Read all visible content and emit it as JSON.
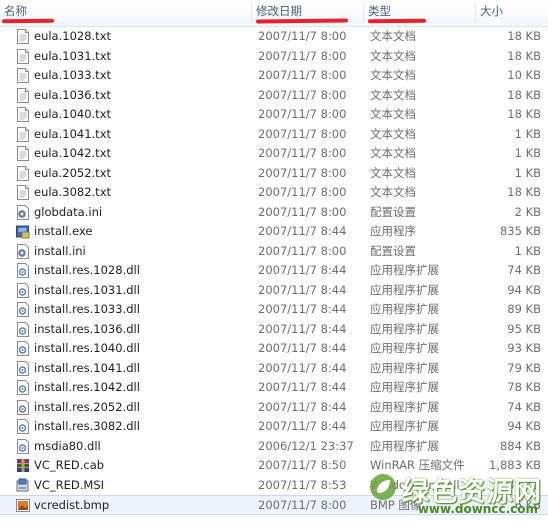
{
  "columns": {
    "name": "名称",
    "date": "修改日期",
    "type": "类型",
    "size": "大小"
  },
  "files": [
    {
      "name": "eula.1028.txt",
      "date": "2007/11/7 8:00",
      "type": "文本文档",
      "size": "18 KB",
      "icon": "text-file-icon"
    },
    {
      "name": "eula.1031.txt",
      "date": "2007/11/7 8:00",
      "type": "文本文档",
      "size": "18 KB",
      "icon": "text-file-icon"
    },
    {
      "name": "eula.1033.txt",
      "date": "2007/11/7 8:00",
      "type": "文本文档",
      "size": "10 KB",
      "icon": "text-file-icon"
    },
    {
      "name": "eula.1036.txt",
      "date": "2007/11/7 8:00",
      "type": "文本文档",
      "size": "18 KB",
      "icon": "text-file-icon"
    },
    {
      "name": "eula.1040.txt",
      "date": "2007/11/7 8:00",
      "type": "文本文档",
      "size": "18 KB",
      "icon": "text-file-icon"
    },
    {
      "name": "eula.1041.txt",
      "date": "2007/11/7 8:00",
      "type": "文本文档",
      "size": "1 KB",
      "icon": "text-file-icon"
    },
    {
      "name": "eula.1042.txt",
      "date": "2007/11/7 8:00",
      "type": "文本文档",
      "size": "1 KB",
      "icon": "text-file-icon"
    },
    {
      "name": "eula.2052.txt",
      "date": "2007/11/7 8:00",
      "type": "文本文档",
      "size": "1 KB",
      "icon": "text-file-icon"
    },
    {
      "name": "eula.3082.txt",
      "date": "2007/11/7 8:00",
      "type": "文本文档",
      "size": "18 KB",
      "icon": "text-file-icon"
    },
    {
      "name": "globdata.ini",
      "date": "2007/11/7 8:00",
      "type": "配置设置",
      "size": "2 KB",
      "icon": "settings-file-icon"
    },
    {
      "name": "install.exe",
      "date": "2007/11/7 8:44",
      "type": "应用程序",
      "size": "835 KB",
      "icon": "installer-exe-icon"
    },
    {
      "name": "install.ini",
      "date": "2007/11/7 8:00",
      "type": "配置设置",
      "size": "1 KB",
      "icon": "settings-file-icon"
    },
    {
      "name": "install.res.1028.dll",
      "date": "2007/11/7 8:44",
      "type": "应用程序扩展",
      "size": "74 KB",
      "icon": "dll-file-icon"
    },
    {
      "name": "install.res.1031.dll",
      "date": "2007/11/7 8:44",
      "type": "应用程序扩展",
      "size": "94 KB",
      "icon": "dll-file-icon"
    },
    {
      "name": "install.res.1033.dll",
      "date": "2007/11/7 8:44",
      "type": "应用程序扩展",
      "size": "89 KB",
      "icon": "dll-file-icon"
    },
    {
      "name": "install.res.1036.dll",
      "date": "2007/11/7 8:44",
      "type": "应用程序扩展",
      "size": "95 KB",
      "icon": "dll-file-icon"
    },
    {
      "name": "install.res.1040.dll",
      "date": "2007/11/7 8:44",
      "type": "应用程序扩展",
      "size": "93 KB",
      "icon": "dll-file-icon"
    },
    {
      "name": "install.res.1041.dll",
      "date": "2007/11/7 8:44",
      "type": "应用程序扩展",
      "size": "79 KB",
      "icon": "dll-file-icon"
    },
    {
      "name": "install.res.1042.dll",
      "date": "2007/11/7 8:44",
      "type": "应用程序扩展",
      "size": "78 KB",
      "icon": "dll-file-icon"
    },
    {
      "name": "install.res.2052.dll",
      "date": "2007/11/7 8:44",
      "type": "应用程序扩展",
      "size": "74 KB",
      "icon": "dll-file-icon"
    },
    {
      "name": "install.res.3082.dll",
      "date": "2007/11/7 8:44",
      "type": "应用程序扩展",
      "size": "94 KB",
      "icon": "dll-file-icon"
    },
    {
      "name": "msdia80.dll",
      "date": "2006/12/1 23:37",
      "type": "应用程序扩展",
      "size": "884 KB",
      "icon": "dll-file-icon"
    },
    {
      "name": "VC_RED.cab",
      "date": "2007/11/7 8:50",
      "type": "WinRAR 压缩文件",
      "size": "1,883 KB",
      "icon": "winrar-archive-icon"
    },
    {
      "name": "VC_RED.MSI",
      "date": "2007/11/7 8:53",
      "type": "Windows Install...",
      "size": "237 KB",
      "icon": "msi-installer-icon"
    },
    {
      "name": "vcredist.bmp",
      "date": "2007/11/7 8:00",
      "type": "BMP 图像",
      "size": "6 KB",
      "icon": "bmp-image-icon",
      "selected": true
    }
  ],
  "watermark": {
    "zh": "绿色资源网",
    "en": "www.downcc.com",
    "icon": "leaf-logo-icon"
  },
  "colors": {
    "header_text": "#4c607a",
    "scribble": "#e8222a",
    "detail_text": "#6d6d6d",
    "watermark_green": "#4a8a22"
  }
}
